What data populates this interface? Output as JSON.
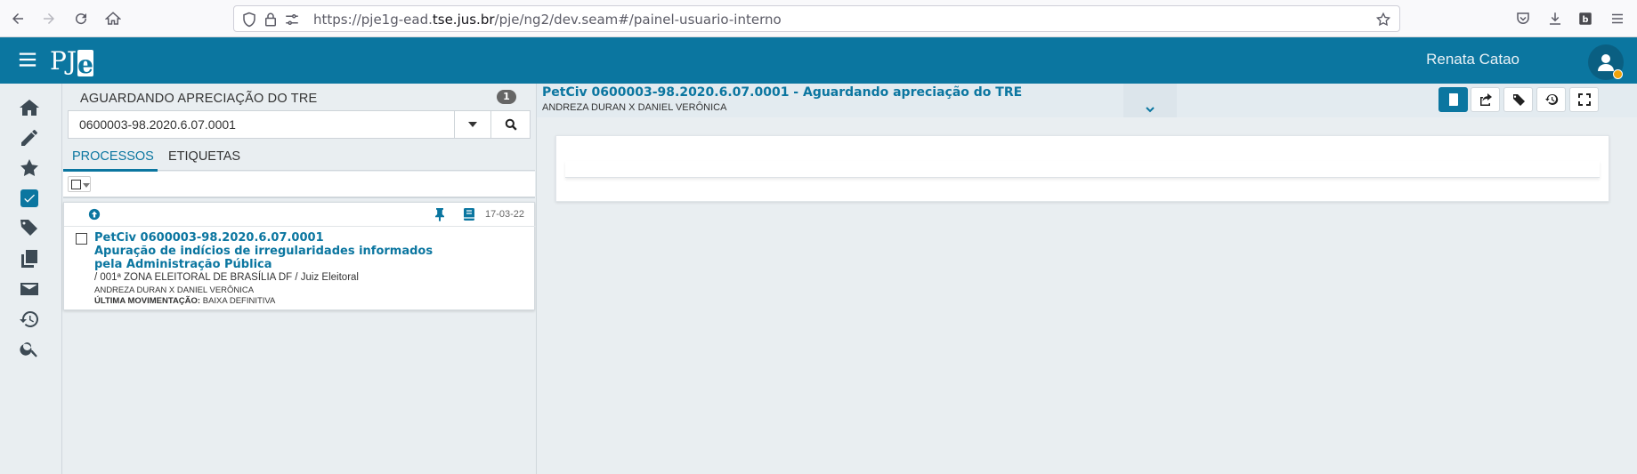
{
  "browser": {
    "url_prefix": "https://pje1g-ead.",
    "url_domain": "tse.jus.br",
    "url_path": "/pje/ng2/dev.seam#/painel-usuario-interno"
  },
  "app": {
    "logo_pj": "PJ",
    "logo_e": "e",
    "user_name": "Renata Catao",
    "brand_color": "#0b76a0"
  },
  "nav": {
    "items": [
      {
        "name": "home-icon"
      },
      {
        "name": "pencil-icon"
      },
      {
        "name": "star-icon"
      },
      {
        "name": "checkbox-icon"
      },
      {
        "name": "tags-icon"
      },
      {
        "name": "copy-icon"
      },
      {
        "name": "envelope-icon"
      },
      {
        "name": "history-icon"
      },
      {
        "name": "search-icon"
      }
    ]
  },
  "panel": {
    "title": "AGUARDANDO APRECIAÇÃO DO TRE",
    "count": "1",
    "search_value": "0600003-98.2020.6.07.0001",
    "tabs": [
      "PROCESSOS",
      "ETIQUETAS"
    ]
  },
  "process": {
    "date": "17-03-22",
    "number": "PetCiv 0600003-98.2020.6.07.0001",
    "subject": "Apuração de indícios de irregularidades informados pela Administração Pública",
    "orgao": "/ 001ª ZONA ELEITORAL DE BRASÍLIA DF / Juiz Eleitoral",
    "partes": "ANDREZA DURAN X DANIEL VERÔNICA",
    "mov_label": "ÚLTIMA MOVIMENTAÇÃO:",
    "mov_value": "BAIXA DEFINITIVA"
  },
  "detail": {
    "title": "PetCiv 0600003-98.2020.6.07.0001 - Aguardando apreciação do TRE",
    "subtitle": "ANDREZA DURAN X DANIEL VERÔNICA",
    "toolbar": [
      "book-icon",
      "share-icon",
      "tag-icon",
      "history-icon",
      "expand-icon"
    ]
  }
}
